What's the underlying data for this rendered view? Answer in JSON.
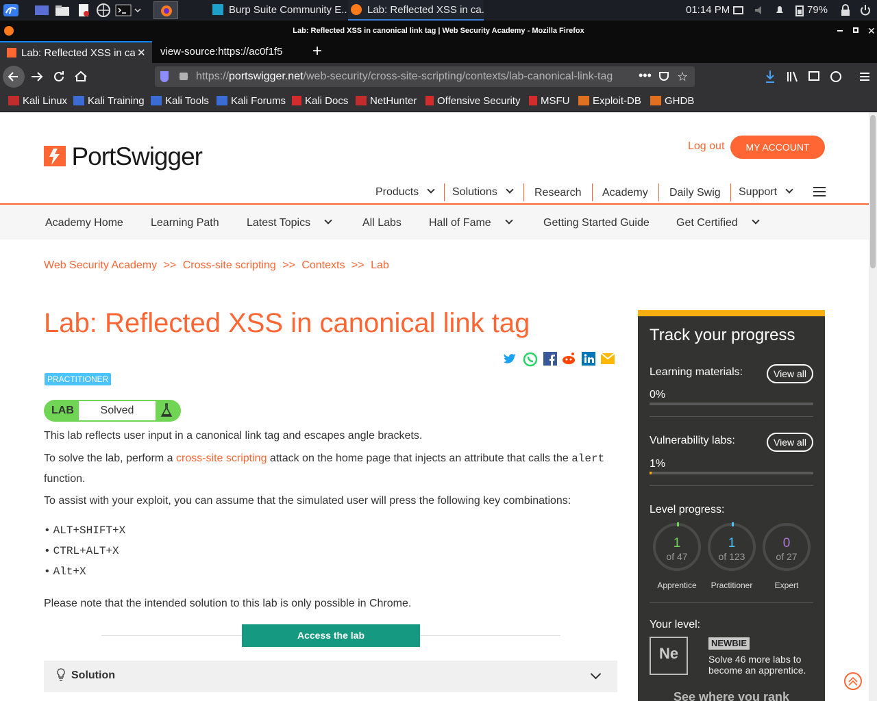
{
  "taskbar": {
    "tasks": [
      {
        "label": "Burp Suite Community E..."
      },
      {
        "label": "Lab: Reflected XSS in ca..."
      }
    ],
    "time": "01:14 PM",
    "battery": "79%"
  },
  "window": {
    "title": "Lab: Reflected XSS in canonical link tag | Web Security Academy - Mozilla Firefox"
  },
  "tabs": [
    {
      "label": "Lab: Reflected XSS in can"
    },
    {
      "label": "view-source:https://ac0f1f5"
    }
  ],
  "urlbar": {
    "prefix": "https://",
    "domain": "portswigger.net",
    "path": "/web-security/cross-site-scripting/contexts/lab-canonical-link-tag"
  },
  "bookmarks": [
    {
      "label": "Kali Linux",
      "color": "#c22c2c"
    },
    {
      "label": "Kali Training",
      "color": "#3b6bd4"
    },
    {
      "label": "Kali Tools",
      "color": "#3b6bd4"
    },
    {
      "label": "Kali Forums",
      "color": "#3b6bd4"
    },
    {
      "label": "Kali Docs",
      "color": "#d42c2c"
    },
    {
      "label": "NetHunter",
      "color": "#c22c2c"
    },
    {
      "label": "Offensive Security",
      "color": "#d42c2c"
    },
    {
      "label": "MSFU",
      "color": "#d42c2c"
    },
    {
      "label": "Exploit-DB",
      "color": "#e07020"
    },
    {
      "label": "GHDB",
      "color": "#e07020"
    }
  ],
  "site": {
    "logo_text": "PortSwigger",
    "logout": "Log out",
    "my_account": "MY ACCOUNT",
    "top_nav": [
      "Products",
      "Solutions",
      "Research",
      "Academy",
      "Daily Swig",
      "Support"
    ],
    "sub_nav": [
      "Academy Home",
      "Learning Path",
      "Latest Topics",
      "All Labs",
      "Hall of Fame",
      "Getting Started Guide",
      "Get Certified"
    ],
    "breadcrumb": [
      "Web Security Academy",
      "Cross-site scripting",
      "Contexts",
      "Lab"
    ],
    "breadcrumb_sep": ">>"
  },
  "lab": {
    "title": "Lab: Reflected XSS in canonical link tag",
    "level": "PRACTITIONER",
    "status_tag": "LAB",
    "status": "Solved",
    "p1": "This lab reflects user input in a canonical link tag and escapes angle brackets.",
    "p2_a": "To solve the lab, perform a ",
    "p2_link": "cross-site scripting",
    "p2_b": " attack on the home page that injects an attribute that calls the ",
    "p2_code": "alert",
    "p2_c": "function.",
    "p3": "To assist with your exploit, you can assume that the simulated user will press the following key combinations:",
    "keys": [
      "ALT+SHIFT+X",
      "CTRL+ALT+X",
      "Alt+X"
    ],
    "p4": "Please note that the intended solution to this lab is only possible in Chrome.",
    "access_button": "Access the lab",
    "solution_label": "Solution"
  },
  "progress": {
    "title": "Track your progress",
    "learning_label": "Learning materials:",
    "learning_value": "0%",
    "learning_fraction": 0,
    "vuln_label": "Vulnerability labs:",
    "vuln_value": "1%",
    "vuln_fraction": 0.01,
    "view_all": "View all",
    "level_label": "Level progress:",
    "levels": [
      {
        "count": "1",
        "of": "of 47",
        "name": "Apprentice",
        "color": "#70d454"
      },
      {
        "count": "1",
        "of": "of 123",
        "name": "Practitioner",
        "color": "#4bc3ff"
      },
      {
        "count": "0",
        "of": "of 27",
        "name": "Expert",
        "color": "#b277d4"
      }
    ],
    "your_level_label": "Your level:",
    "badge_symbol": "Ne",
    "badge_name": "NEWBIE",
    "badge_text": "Solve 46 more labs to become an apprentice.",
    "rank_link": "See where you rank"
  },
  "colors": {
    "brand_orange": "#ff6633",
    "progress_yellow": "#f9ae0f",
    "access_green": "#159980",
    "lab_green": "#70d454"
  }
}
